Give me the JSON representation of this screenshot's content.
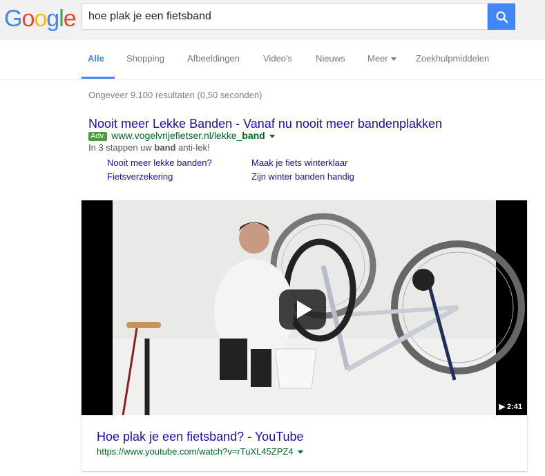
{
  "logo": {
    "text": "Google",
    "letters": [
      "G",
      "o",
      "o",
      "g",
      "l",
      "e"
    ],
    "colors": [
      "#4285f4",
      "#ea4335",
      "#fbbc05",
      "#4285f4",
      "#34a853",
      "#ea4335"
    ]
  },
  "search": {
    "query": "hoe plak je een fietsband",
    "button_icon": "search-icon",
    "button_color": "#4285f4"
  },
  "nav": {
    "items": [
      "Alle",
      "Shopping",
      "Afbeeldingen",
      "Video's",
      "Nieuws",
      "Meer",
      "Zoekhulpmiddelen"
    ],
    "active": "Alle",
    "active_color": "#4285f4"
  },
  "result_stats": "Ongeveer 9.100 resultaten (0,50 seconden)",
  "ad": {
    "title": "Nooit meer Lekke Banden - Vanaf nu nooit meer bandenplakken",
    "badge": "Adv.",
    "url_prefix": "www.vogelvrijefietser.nl/lekke_",
    "url_bold": "band",
    "desc_prefix": "In 3 stappen uw ",
    "desc_bold": "band",
    "desc_suffix": " anti-lek!",
    "sitelinks": [
      "Nooit meer lekke banden?",
      "Maak je fiets winterklaar",
      "Fietsverzekering",
      "Zijn winter banden handig"
    ]
  },
  "video": {
    "duration": "2:41",
    "duration_icon": "play-small-icon",
    "title": "Hoe plak je een fietsband? - YouTube",
    "url": "https://www.youtube.com/watch?v=rTuXL45ZPZ4"
  },
  "colors": {
    "link": "#1a0dab",
    "url_green": "#006621",
    "ad_badge": "#4d9a45"
  }
}
